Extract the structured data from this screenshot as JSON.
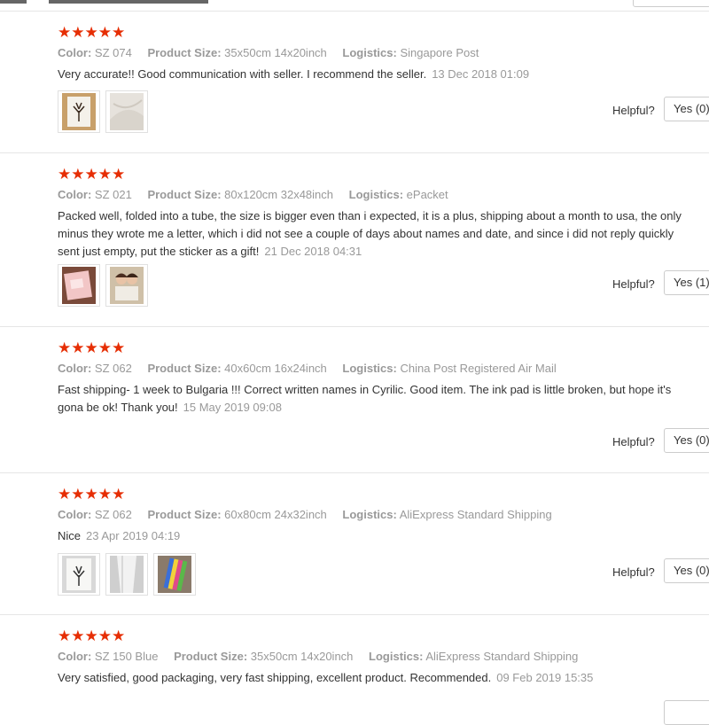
{
  "accent_color": "#e62e04",
  "star_glyph": "★★★★★",
  "labels": {
    "color": "Color:",
    "size": "Product Size:",
    "logistics": "Logistics:",
    "helpful": "Helpful?"
  },
  "reviews": [
    {
      "rating": 5,
      "color": "SZ 074",
      "size": "35x50cm 14x20inch",
      "logistics": "Singapore Post",
      "text": "Very accurate!! Good communication with seller. I recommend the seller.",
      "date": "13 Dec 2018 01:09",
      "yes": "Yes (0)",
      "photos": [
        "tree-print-photo",
        "fabric-photo"
      ]
    },
    {
      "rating": 5,
      "color": "SZ 021",
      "size": "80x120cm 32x48inch",
      "logistics": "ePacket",
      "text": "Packed well, folded into a tube, the size is bigger even than i expected, it is a plus, shipping about a month to usa, the only minus they wrote me a letter, which i did not see a couple of days about names and date, and since i did not reply quickly sent just empty, put the sticker as a gift!",
      "date": "21 Dec 2018 04:31",
      "yes": "Yes (1)",
      "photos": [
        "pink-card-photo",
        "couple-photo"
      ]
    },
    {
      "rating": 5,
      "color": "SZ 062",
      "size": "40x60cm 16x24inch",
      "logistics": "China Post Registered Air Mail",
      "text": "Fast shipping- 1 week to Bulgaria !!! Correct written names in Cyrilic. Good item. The ink pad is little broken, but hope it's gona be ok! Thank you!",
      "date": "15 May 2019 09:08",
      "yes": "Yes (0)",
      "photos": []
    },
    {
      "rating": 5,
      "color": "SZ 062",
      "size": "60x80cm 24x32inch",
      "logistics": "AliExpress Standard Shipping",
      "text": "Nice",
      "date": "23 Apr 2019 04:19",
      "yes": "Yes (0)",
      "photos": [
        "tree-canvas-photo",
        "rolled-canvas-photo",
        "ink-pad-photo"
      ]
    },
    {
      "rating": 5,
      "color": "SZ 150 Blue",
      "size": "35x50cm 14x20inch",
      "logistics": "AliExpress Standard Shipping",
      "text": "Very satisfied, good packaging, very fast shipping, excellent product. Recommended.",
      "date": "09 Feb 2019 15:35",
      "yes": "",
      "photos": []
    }
  ]
}
